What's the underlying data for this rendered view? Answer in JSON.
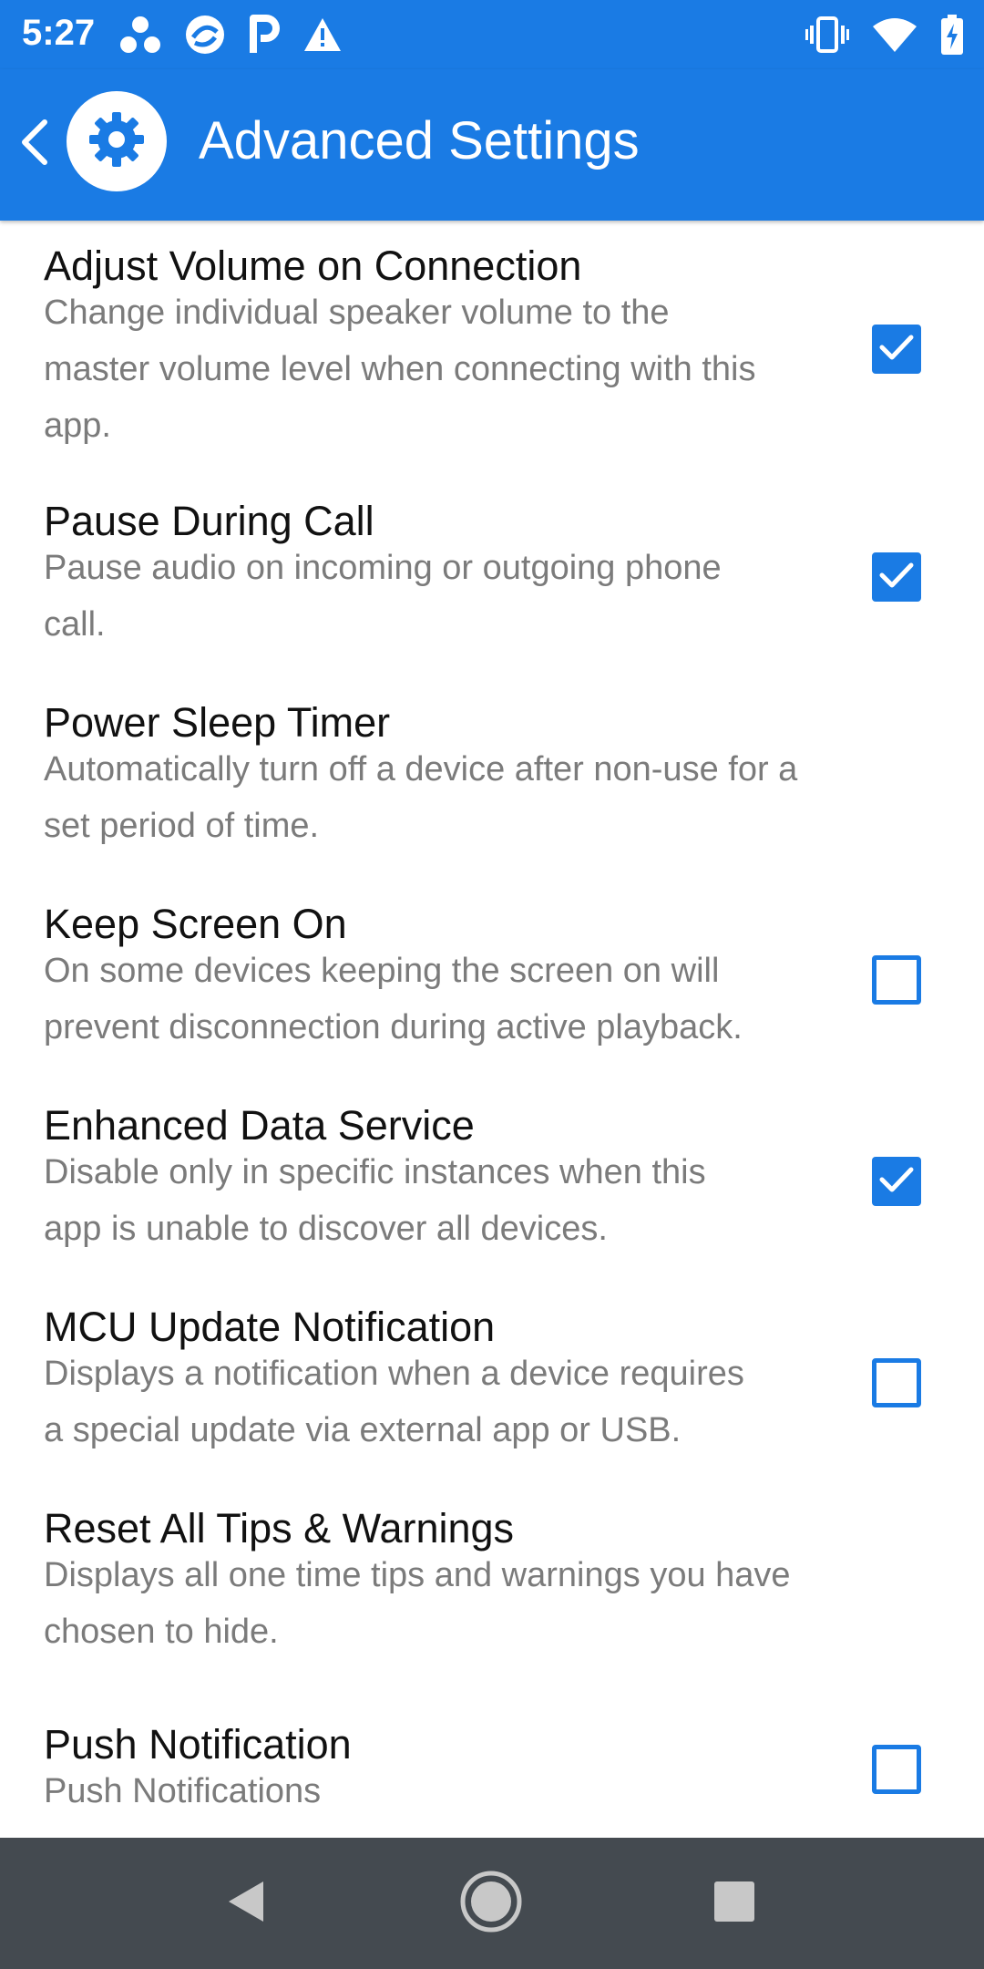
{
  "status_bar": {
    "time": "5:27",
    "left_icons": [
      "notification-app-icon-1",
      "notification-app-icon-2",
      "parking-icon",
      "warning-icon"
    ],
    "right_icons": [
      "vibrate-icon",
      "wifi-icon",
      "battery-charging-icon"
    ]
  },
  "app_bar": {
    "title": "Advanced Settings",
    "logo_icon": "gear-icon",
    "back_icon": "chevron-left-icon"
  },
  "settings": [
    {
      "title": "Adjust Volume on Connection",
      "desc_lines": [
        "Change individual speaker volume to the",
        "master volume level when connecting with this",
        "app."
      ],
      "checkbox": "checked"
    },
    {
      "title": "Pause During Call",
      "desc_lines": [
        "Pause audio on incoming or outgoing phone",
        "call."
      ],
      "checkbox": "checked"
    },
    {
      "title": "Power Sleep Timer",
      "desc_lines": [
        "Automatically turn off a device after non-use for a",
        "set period of time."
      ],
      "checkbox": null
    },
    {
      "title": "Keep Screen On",
      "desc_lines": [
        "On some devices keeping the screen on will",
        "prevent disconnection during active playback."
      ],
      "checkbox": "unchecked"
    },
    {
      "title": "Enhanced Data Service",
      "desc_lines": [
        "Disable only in specific instances when this",
        "app is unable to discover all devices."
      ],
      "checkbox": "checked"
    },
    {
      "title": "MCU Update Notification",
      "desc_lines": [
        "Displays a notification when a device requires",
        "a special update via external app or USB."
      ],
      "checkbox": "unchecked"
    },
    {
      "title": "Reset All Tips & Warnings",
      "desc_lines": [
        "Displays all one time tips and warnings you have",
        "chosen to hide."
      ],
      "checkbox": null
    },
    {
      "title": "Push Notification",
      "desc_lines": [
        "Push Notifications"
      ],
      "checkbox": "unchecked"
    }
  ],
  "nav_bar": {
    "buttons": [
      "back-triangle-icon",
      "home-circle-icon",
      "recents-square-icon"
    ]
  },
  "colors": {
    "accent": "#1a7be4",
    "title_text": "#111111",
    "desc_text": "#7b7b7b",
    "nav_bar": "#444a50"
  }
}
